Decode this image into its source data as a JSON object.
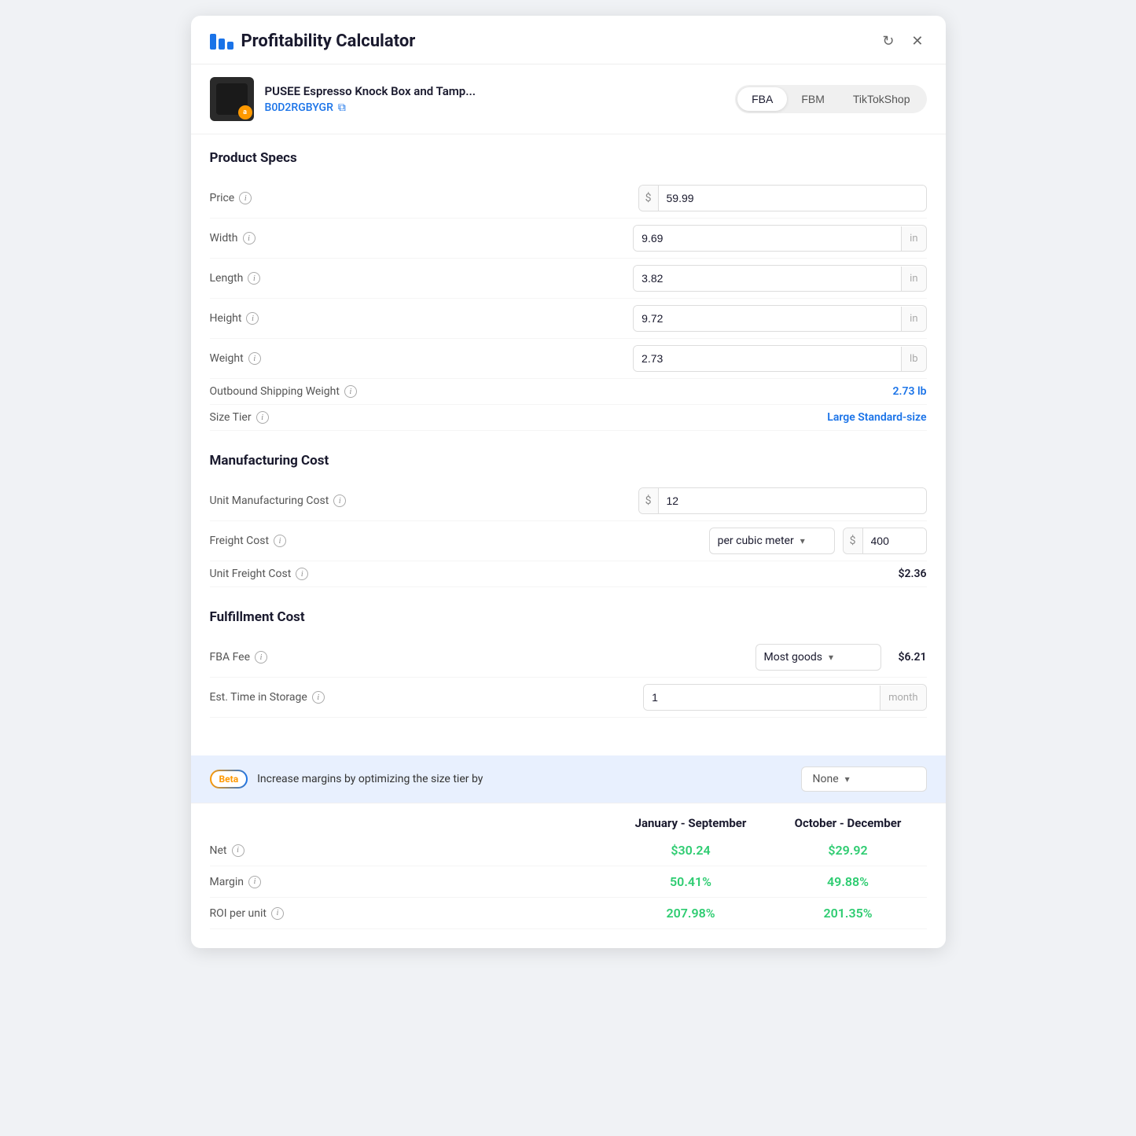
{
  "app": {
    "title": "Profitability Calculator"
  },
  "product": {
    "name": "PUSEE Espresso Knock Box and Tamp...",
    "id": "B0D2RGBYGR",
    "tabs": [
      "FBA",
      "FBM",
      "TikTokShop"
    ],
    "active_tab": "FBA"
  },
  "product_specs": {
    "section_title": "Product Specs",
    "fields": {
      "price": {
        "label": "Price",
        "value": "59.99",
        "prefix": "$",
        "suffix": ""
      },
      "width": {
        "label": "Width",
        "value": "9.69",
        "suffix": "in"
      },
      "length": {
        "label": "Length",
        "value": "3.82",
        "suffix": "in"
      },
      "height": {
        "label": "Height",
        "value": "9.72",
        "suffix": "in"
      },
      "weight": {
        "label": "Weight",
        "value": "2.73",
        "suffix": "lb"
      },
      "outbound_shipping_weight": {
        "label": "Outbound Shipping Weight",
        "value": "2.73 lb"
      },
      "size_tier": {
        "label": "Size Tier",
        "value": "Large Standard-size"
      }
    }
  },
  "manufacturing_cost": {
    "section_title": "Manufacturing Cost",
    "fields": {
      "unit_manufacturing_cost": {
        "label": "Unit Manufacturing Cost",
        "value": "12",
        "prefix": "$"
      },
      "freight_cost": {
        "label": "Freight Cost",
        "dropdown_value": "per cubic meter",
        "amount": "400",
        "prefix": "$"
      },
      "unit_freight_cost": {
        "label": "Unit Freight Cost",
        "value": "$2.36"
      }
    }
  },
  "fulfillment_cost": {
    "section_title": "Fulfillment Cost",
    "fields": {
      "fba_fee": {
        "label": "FBA Fee",
        "dropdown_value": "Most goods",
        "value": "$6.21"
      },
      "est_time_in_storage": {
        "label": "Est. Time in Storage",
        "value": "1",
        "suffix": "month"
      }
    }
  },
  "beta_banner": {
    "badge": "Beta",
    "text": "Increase margins by optimizing the size tier by",
    "dropdown_value": "None"
  },
  "results": {
    "periods": [
      "January - September",
      "October - December"
    ],
    "rows": [
      {
        "label": "Net",
        "help": true,
        "jan_sep": "$30.24",
        "oct_dec": "$29.92"
      },
      {
        "label": "Margin",
        "help": true,
        "jan_sep": "50.41%",
        "oct_dec": "49.88%"
      },
      {
        "label": "ROI per unit",
        "help": true,
        "jan_sep": "207.98%",
        "oct_dec": "201.35%"
      }
    ]
  },
  "icons": {
    "refresh": "↻",
    "close": "✕",
    "copy": "⧉",
    "chevron_down": "▾",
    "dollar": "$",
    "help": "i"
  }
}
